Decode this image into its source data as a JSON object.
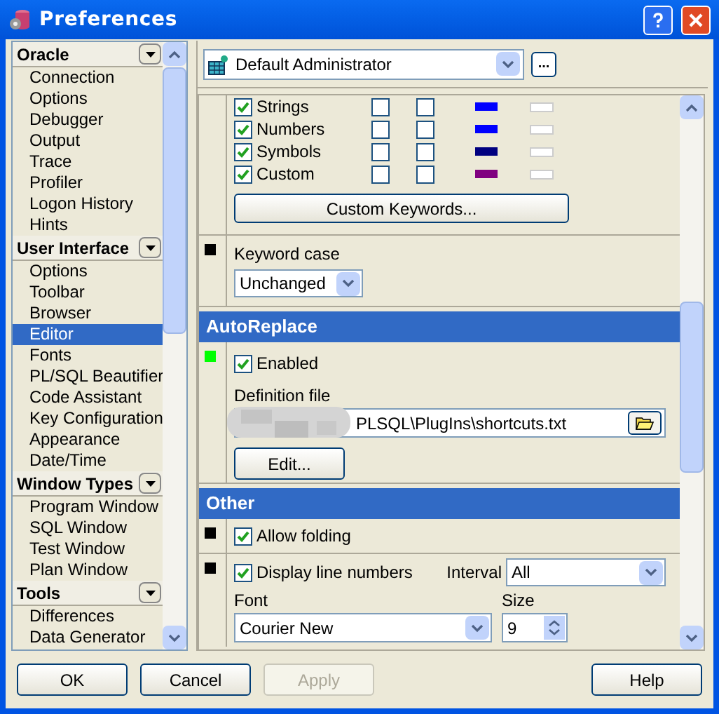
{
  "window": {
    "title": "Preferences"
  },
  "sidebar": {
    "groups": [
      {
        "title": "Oracle",
        "items": [
          {
            "label": "Connection",
            "selected": false
          },
          {
            "label": "Options",
            "selected": false
          },
          {
            "label": "Debugger",
            "selected": false
          },
          {
            "label": "Output",
            "selected": false
          },
          {
            "label": "Trace",
            "selected": false
          },
          {
            "label": "Profiler",
            "selected": false
          },
          {
            "label": "Logon History",
            "selected": false
          },
          {
            "label": "Hints",
            "selected": false
          }
        ]
      },
      {
        "title": "User Interface",
        "items": [
          {
            "label": "Options",
            "selected": false
          },
          {
            "label": "Toolbar",
            "selected": false
          },
          {
            "label": "Browser",
            "selected": false
          },
          {
            "label": "Editor",
            "selected": true
          },
          {
            "label": "Fonts",
            "selected": false
          },
          {
            "label": "PL/SQL Beautifier",
            "selected": false
          },
          {
            "label": "Code Assistant",
            "selected": false
          },
          {
            "label": "Key Configuration",
            "selected": false
          },
          {
            "label": "Appearance",
            "selected": false
          },
          {
            "label": "Date/Time",
            "selected": false
          }
        ]
      },
      {
        "title": "Window Types",
        "items": [
          {
            "label": "Program Window",
            "selected": false
          },
          {
            "label": "SQL Window",
            "selected": false
          },
          {
            "label": "Test Window",
            "selected": false
          },
          {
            "label": "Plan Window",
            "selected": false
          }
        ]
      },
      {
        "title": "Tools",
        "items": [
          {
            "label": "Differences",
            "selected": false
          },
          {
            "label": "Data Generator",
            "selected": false
          }
        ]
      }
    ]
  },
  "profile": {
    "value": "Default Administrator",
    "more_button": "..."
  },
  "syntax_items": [
    {
      "label": "Strings",
      "checked": true,
      "bold": false,
      "italic": false,
      "color": "#0000ff"
    },
    {
      "label": "Numbers",
      "checked": true,
      "bold": false,
      "italic": false,
      "color": "#0000ff"
    },
    {
      "label": "Symbols",
      "checked": true,
      "bold": false,
      "italic": false,
      "color": "#000080"
    },
    {
      "label": "Custom",
      "checked": true,
      "bold": false,
      "italic": false,
      "color": "#800080"
    }
  ],
  "custom_keywords_button": "Custom Keywords...",
  "keyword_case": {
    "color": "#000000",
    "label": "Keyword case",
    "value": "Unchanged"
  },
  "autoreplace": {
    "title": "AutoReplace",
    "color": "#00ff00",
    "enabled": {
      "label": "Enabled",
      "checked": true
    },
    "file_label": "Definition file",
    "file_value": "PLSQL\\PlugIns\\shortcuts.txt",
    "edit_button": "Edit..."
  },
  "other": {
    "title": "Other",
    "folding": {
      "color": "#000000",
      "label": "Allow folding",
      "checked": true
    },
    "line_numbers": {
      "color": "#000000",
      "label": "Display line numbers",
      "checked": true,
      "interval_label": "Interval",
      "interval_value": "All",
      "font_label": "Font",
      "font_value": "Courier New",
      "size_label": "Size",
      "size_value": "9"
    }
  },
  "buttons": [
    {
      "label": "OK",
      "disabled": false
    },
    {
      "label": "Cancel",
      "disabled": false
    },
    {
      "label": "Apply",
      "disabled": true
    },
    {
      "label": "Help",
      "disabled": false
    }
  ]
}
